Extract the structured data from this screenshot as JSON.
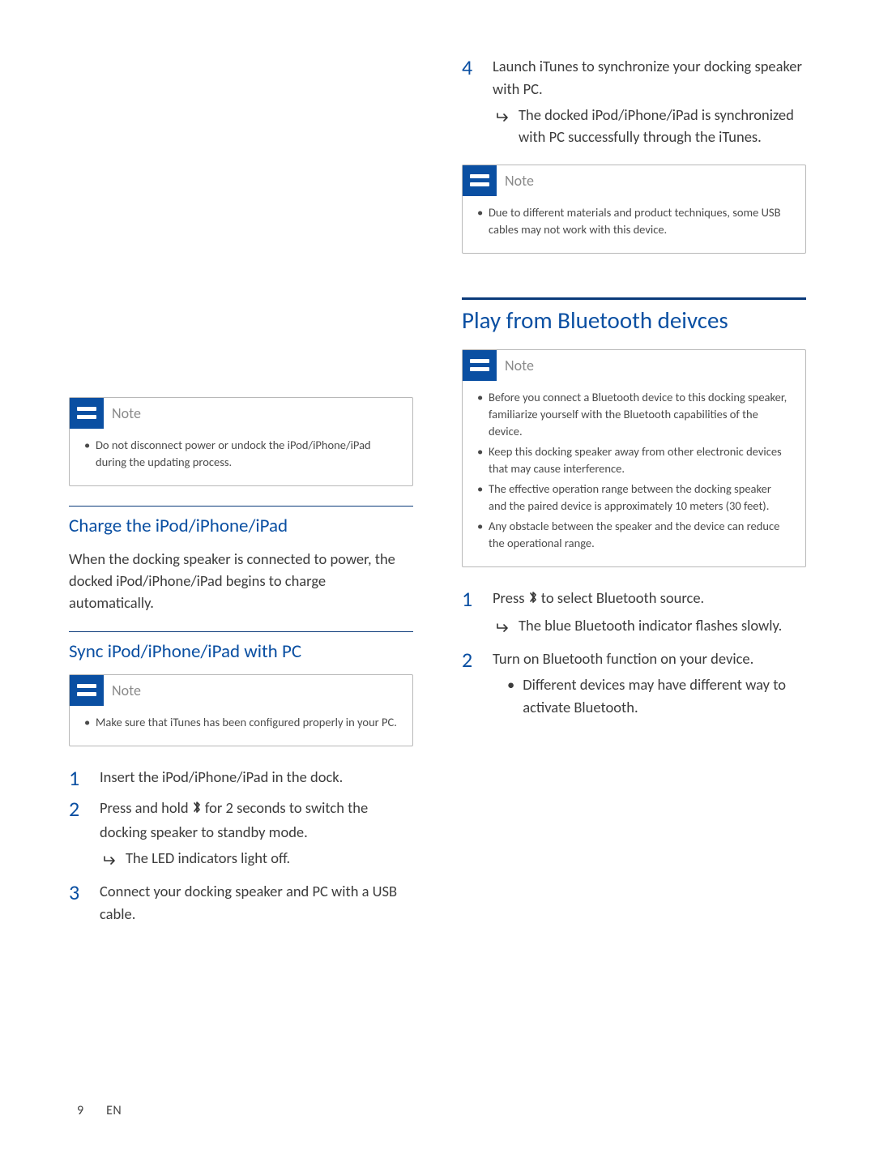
{
  "note_label": "Note",
  "left": {
    "note1": {
      "items": [
        "Do not disconnect power or undock the iPod/iPhone/iPad during the updating process."
      ]
    },
    "charge": {
      "title": "Charge the iPod/iPhone/iPad",
      "body": "When the docking speaker is connected to power, the docked iPod/iPhone/iPad begins to charge automatically."
    },
    "sync": {
      "title": "Sync iPod/iPhone/iPad with PC",
      "note_items": [
        "Make sure that iTunes has been configured properly in your PC."
      ],
      "steps": {
        "s1": "Insert the iPod/iPhone/iPad in the dock.",
        "s2a": "Press and hold ",
        "s2b": " for 2 seconds to switch the docking speaker to standby mode.",
        "s2_result": "The LED indicators light off.",
        "s3": "Connect your docking speaker and PC with a USB cable."
      }
    }
  },
  "right": {
    "step4": {
      "text": "Launch iTunes to synchronize your docking speaker with PC.",
      "result": "The docked iPod/iPhone/iPad is synchronized with PC successfully through the iTunes."
    },
    "note_usb": {
      "items": [
        "Due to different materials and product techniques, some USB cables may not work with this device."
      ]
    },
    "bluetooth": {
      "title": "Play from Bluetooth deivces",
      "note_items": [
        "Before you connect a Bluetooth device to this docking speaker, familiarize yourself with the Bluetooth capabilities of the device.",
        "Keep this docking speaker away from other electronic devices that may cause interference.",
        "The effective operation range between the docking speaker and the paired device is approximately 10 meters (30 feet).",
        "Any obstacle between the speaker and the device can reduce the operational range."
      ],
      "s1a": "Press ",
      "s1b": " to select Bluetooth source.",
      "s1_result": "The blue Bluetooth indicator flashes slowly.",
      "s2": "Turn on Bluetooth function on your device.",
      "s2_sub": "Different devices may have different way to activate Bluetooth."
    }
  },
  "footer": {
    "page": "9",
    "lang": "EN"
  }
}
